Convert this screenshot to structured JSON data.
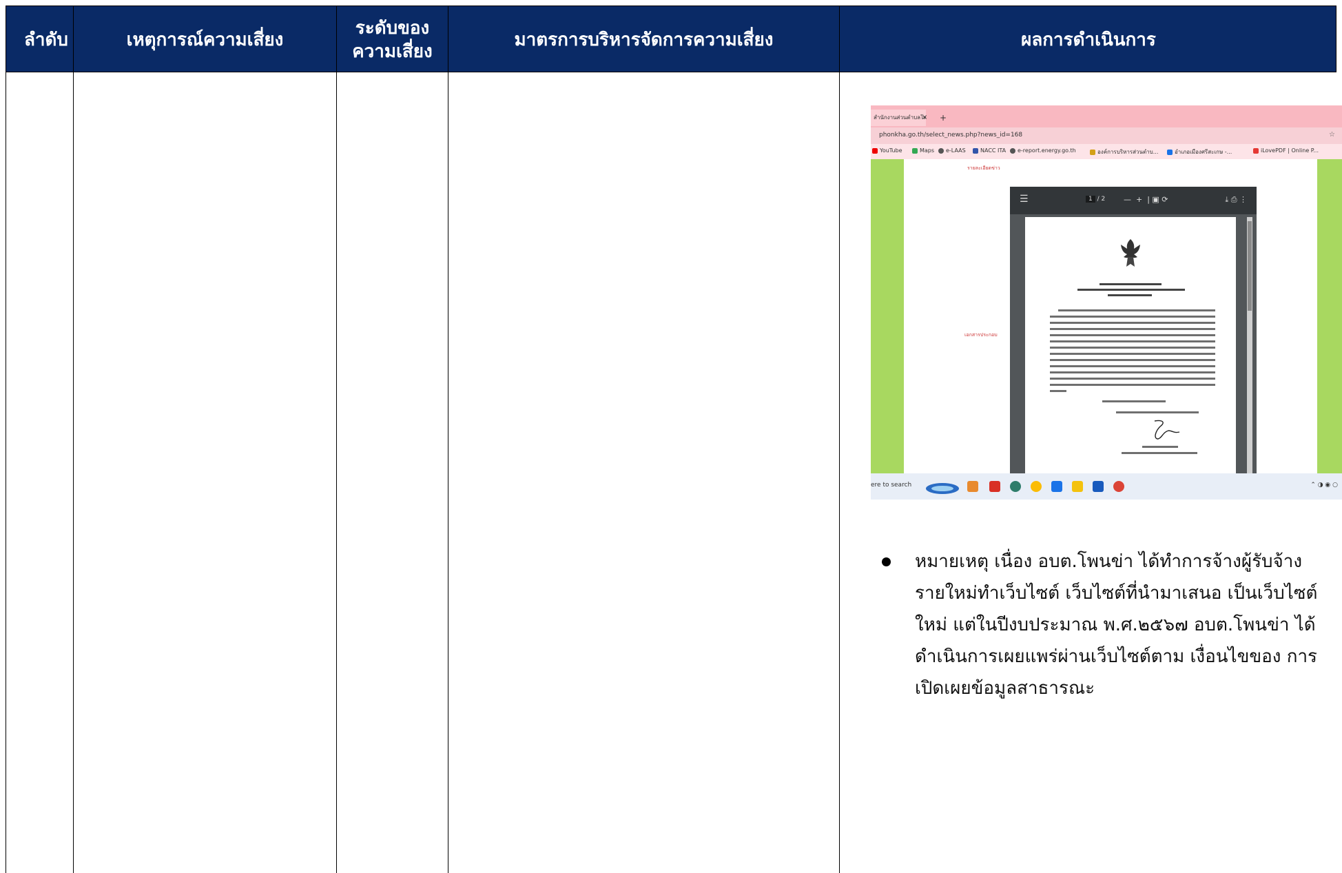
{
  "table": {
    "headers": [
      "ลำดับ",
      "เหตุการณ์ความเสี่ยง",
      "ระดับของความเสี่ยง",
      "มาตรการบริหารจัดการความเสี่ยง",
      "ผลการดำเนินการ"
    ]
  },
  "screenshot": {
    "tab_label": "สำนักงานส่วนตำบลโพนข่า อำเภ",
    "tab_close": "×",
    "tab_new": "+",
    "url": "phonkha.go.th/select_news.php?news_id=168",
    "bookmarks": [
      "YouTube",
      "Maps",
      "e-LAAS",
      "NACC ITA",
      "e-report.energy.go.th",
      "องค์การบริหารส่วนตำบ...",
      "อำเภอเมืองศรีสะเกษ -...",
      "iLovePDF | Online P..."
    ],
    "label_detail": "รายละเอียดข่าว",
    "label_doc": "เอกสารประกอบ",
    "pdf_page": "1",
    "pdf_total": "/ 2",
    "taskbar_search": "ere to search"
  },
  "note": {
    "lines": [
      "หมายเหตุ เนื่อง อบต.โพนข่า ได้ทำการจ้างผู้รับจ้าง",
      "รายใหม่ทำเว็บไซต์  เว็บไซต์ที่นำมาเสนอ เป็นเว็บไซต์",
      "ใหม่ แต่ในปีงบประมาณ พ.ศ.๒๕๖๗ อบต.โพนข่า ได้",
      "ดำเนินการเผยแพร่ผ่านเว็บไซต์ตาม  เงื่อนไขของ การ",
      "เปิดเผยข้อมูลสาธารณะ"
    ]
  },
  "colors": {
    "header_bg": "#0a2a66",
    "header_text": "#ffffff"
  }
}
